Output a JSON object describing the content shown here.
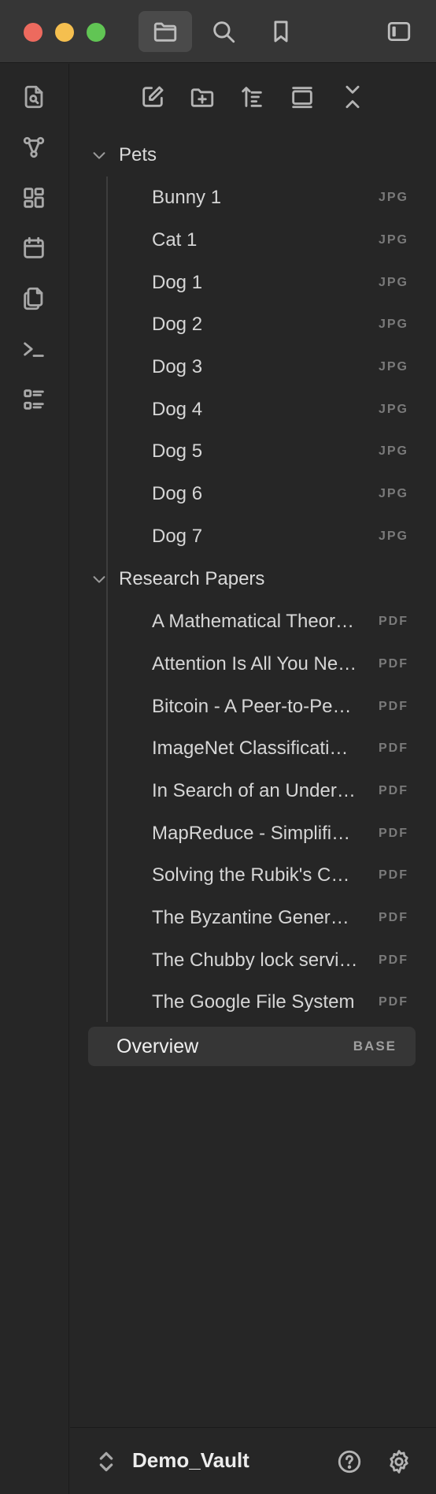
{
  "window": {
    "tabs": [
      {
        "icon": "folder-icon",
        "active": true
      },
      {
        "icon": "search-icon",
        "active": false
      },
      {
        "icon": "bookmark-icon",
        "active": false
      }
    ],
    "sidebar_toggle_icon": "sidebar-toggle-icon"
  },
  "ribbon": {
    "icons": [
      "file-search-icon",
      "graph-icon",
      "dashboard-icon",
      "calendar-icon",
      "copy-icon",
      "terminal-icon",
      "list-icon"
    ]
  },
  "file_nav": {
    "actions": [
      "new-note-icon",
      "new-folder-icon",
      "sort-icon",
      "auto-reveal-icon",
      "collapse-all-icon"
    ]
  },
  "tree": {
    "folders": [
      {
        "label": "Pets",
        "files": [
          {
            "name": "Bunny 1",
            "ext": "JPG"
          },
          {
            "name": "Cat 1",
            "ext": "JPG"
          },
          {
            "name": "Dog 1",
            "ext": "JPG"
          },
          {
            "name": "Dog 2",
            "ext": "JPG"
          },
          {
            "name": "Dog 3",
            "ext": "JPG"
          },
          {
            "name": "Dog 4",
            "ext": "JPG"
          },
          {
            "name": "Dog 5",
            "ext": "JPG"
          },
          {
            "name": "Dog 6",
            "ext": "JPG"
          },
          {
            "name": "Dog 7",
            "ext": "JPG"
          }
        ]
      },
      {
        "label": "Research Papers",
        "files": [
          {
            "name": "A Mathematical Theory of Communication",
            "ext": "PDF"
          },
          {
            "name": "Attention Is All You Need",
            "ext": "PDF"
          },
          {
            "name": "Bitcoin - A Peer-to-Peer Electronic Cash System",
            "ext": "PDF"
          },
          {
            "name": "ImageNet Classification with Deep Convolutional Neural Networks",
            "ext": "PDF"
          },
          {
            "name": "In Search of an Understandable Consensus Algorithm",
            "ext": "PDF"
          },
          {
            "name": "MapReduce - Simplified Data Processing on Large Clusters",
            "ext": "PDF"
          },
          {
            "name": "Solving the Rubik's Cube",
            "ext": "PDF"
          },
          {
            "name": "The Byzantine Generals Problem",
            "ext": "PDF"
          },
          {
            "name": "The Chubby lock service",
            "ext": "PDF"
          },
          {
            "name": "The Google File System",
            "ext": "PDF"
          }
        ]
      }
    ],
    "root_file": {
      "name": "Overview",
      "ext": "BASE"
    }
  },
  "bottom": {
    "vault_name": "Demo_Vault",
    "help_icon": "help-icon",
    "settings_icon": "gear-icon"
  }
}
